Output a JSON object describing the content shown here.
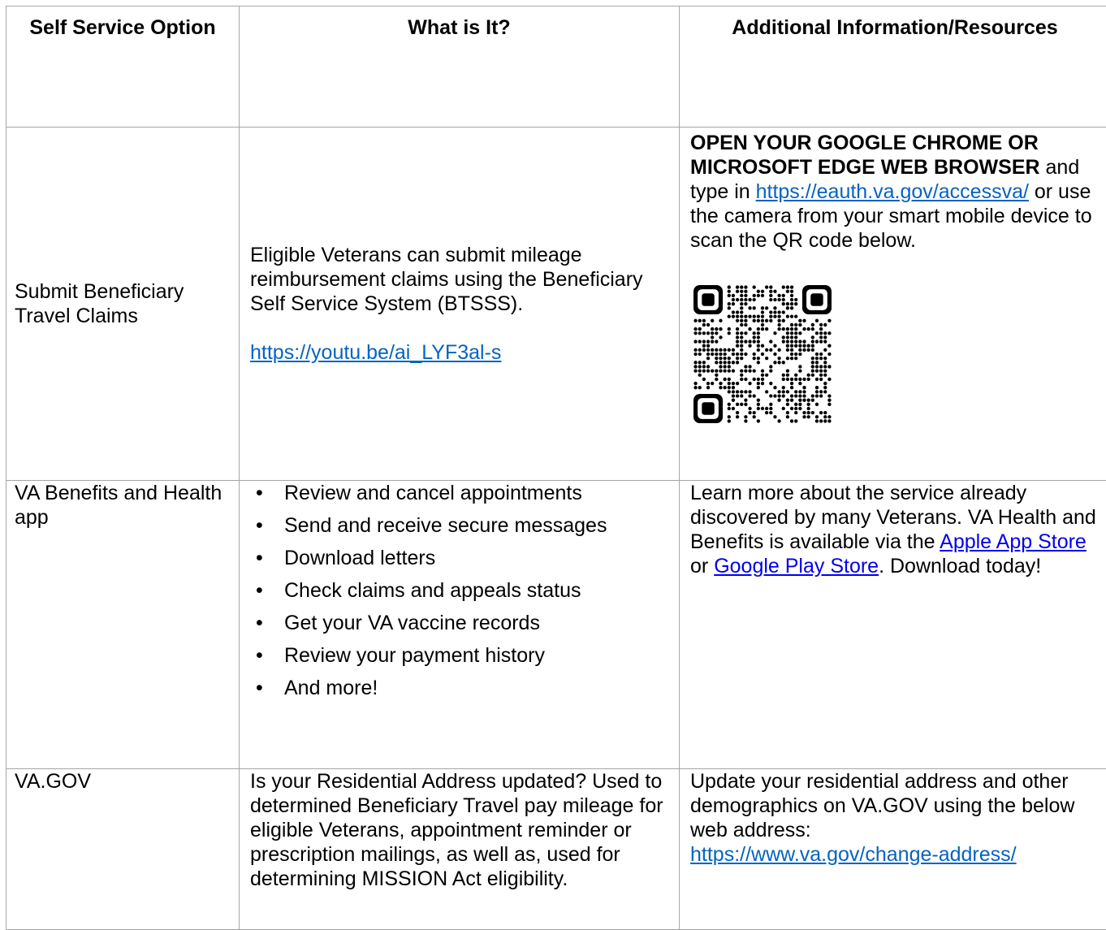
{
  "header": {
    "col1": "Self Service Option",
    "col2": "What is It?",
    "col3": "Additional Information/Resources"
  },
  "row1": {
    "option": "Submit Beneficiary Travel Claims",
    "what_text": "Eligible Veterans can submit mileage reimbursement claims using the Beneficiary Self Service System (BTSSS).",
    "what_link": "https://youtu.be/ai_LYF3al-s",
    "info_bold": "OPEN YOUR GOOGLE CHROME OR MICROSOFT EDGE WEB BROWSER",
    "info_text1": " and type in ",
    "info_link": "https://eauth.va.gov/accessva/",
    "info_text2": " or use the camera from your smart mobile device to scan the QR code below.",
    "qr_icon": "qr-code-icon"
  },
  "row2": {
    "option": "VA Benefits and Health app",
    "bullets": [
      "Review and cancel appointments",
      "Send and receive secure messages",
      "Download letters",
      "Check claims and appeals status",
      "Get your VA vaccine records",
      "Review your payment history",
      "And more!"
    ],
    "info_text1": "Learn more about the service already discovered by many Veterans. VA Health and Benefits is available via the ",
    "info_link1": "Apple App Store",
    "info_text2": " or ",
    "info_link2": "Google Play Store",
    "info_text3": ". Download today!"
  },
  "row3": {
    "option": "VA.GOV",
    "what_text": "Is your Residential Address updated? Used to determined Beneficiary Travel pay mileage for eligible Veterans, appointment reminder or prescription mailings, as well as, used for determining MISSION Act eligibility.",
    "info_text": "Update your residential address and other demographics on VA.GOV using the below web address:",
    "info_link": "https://www.va.gov/change-address/"
  }
}
